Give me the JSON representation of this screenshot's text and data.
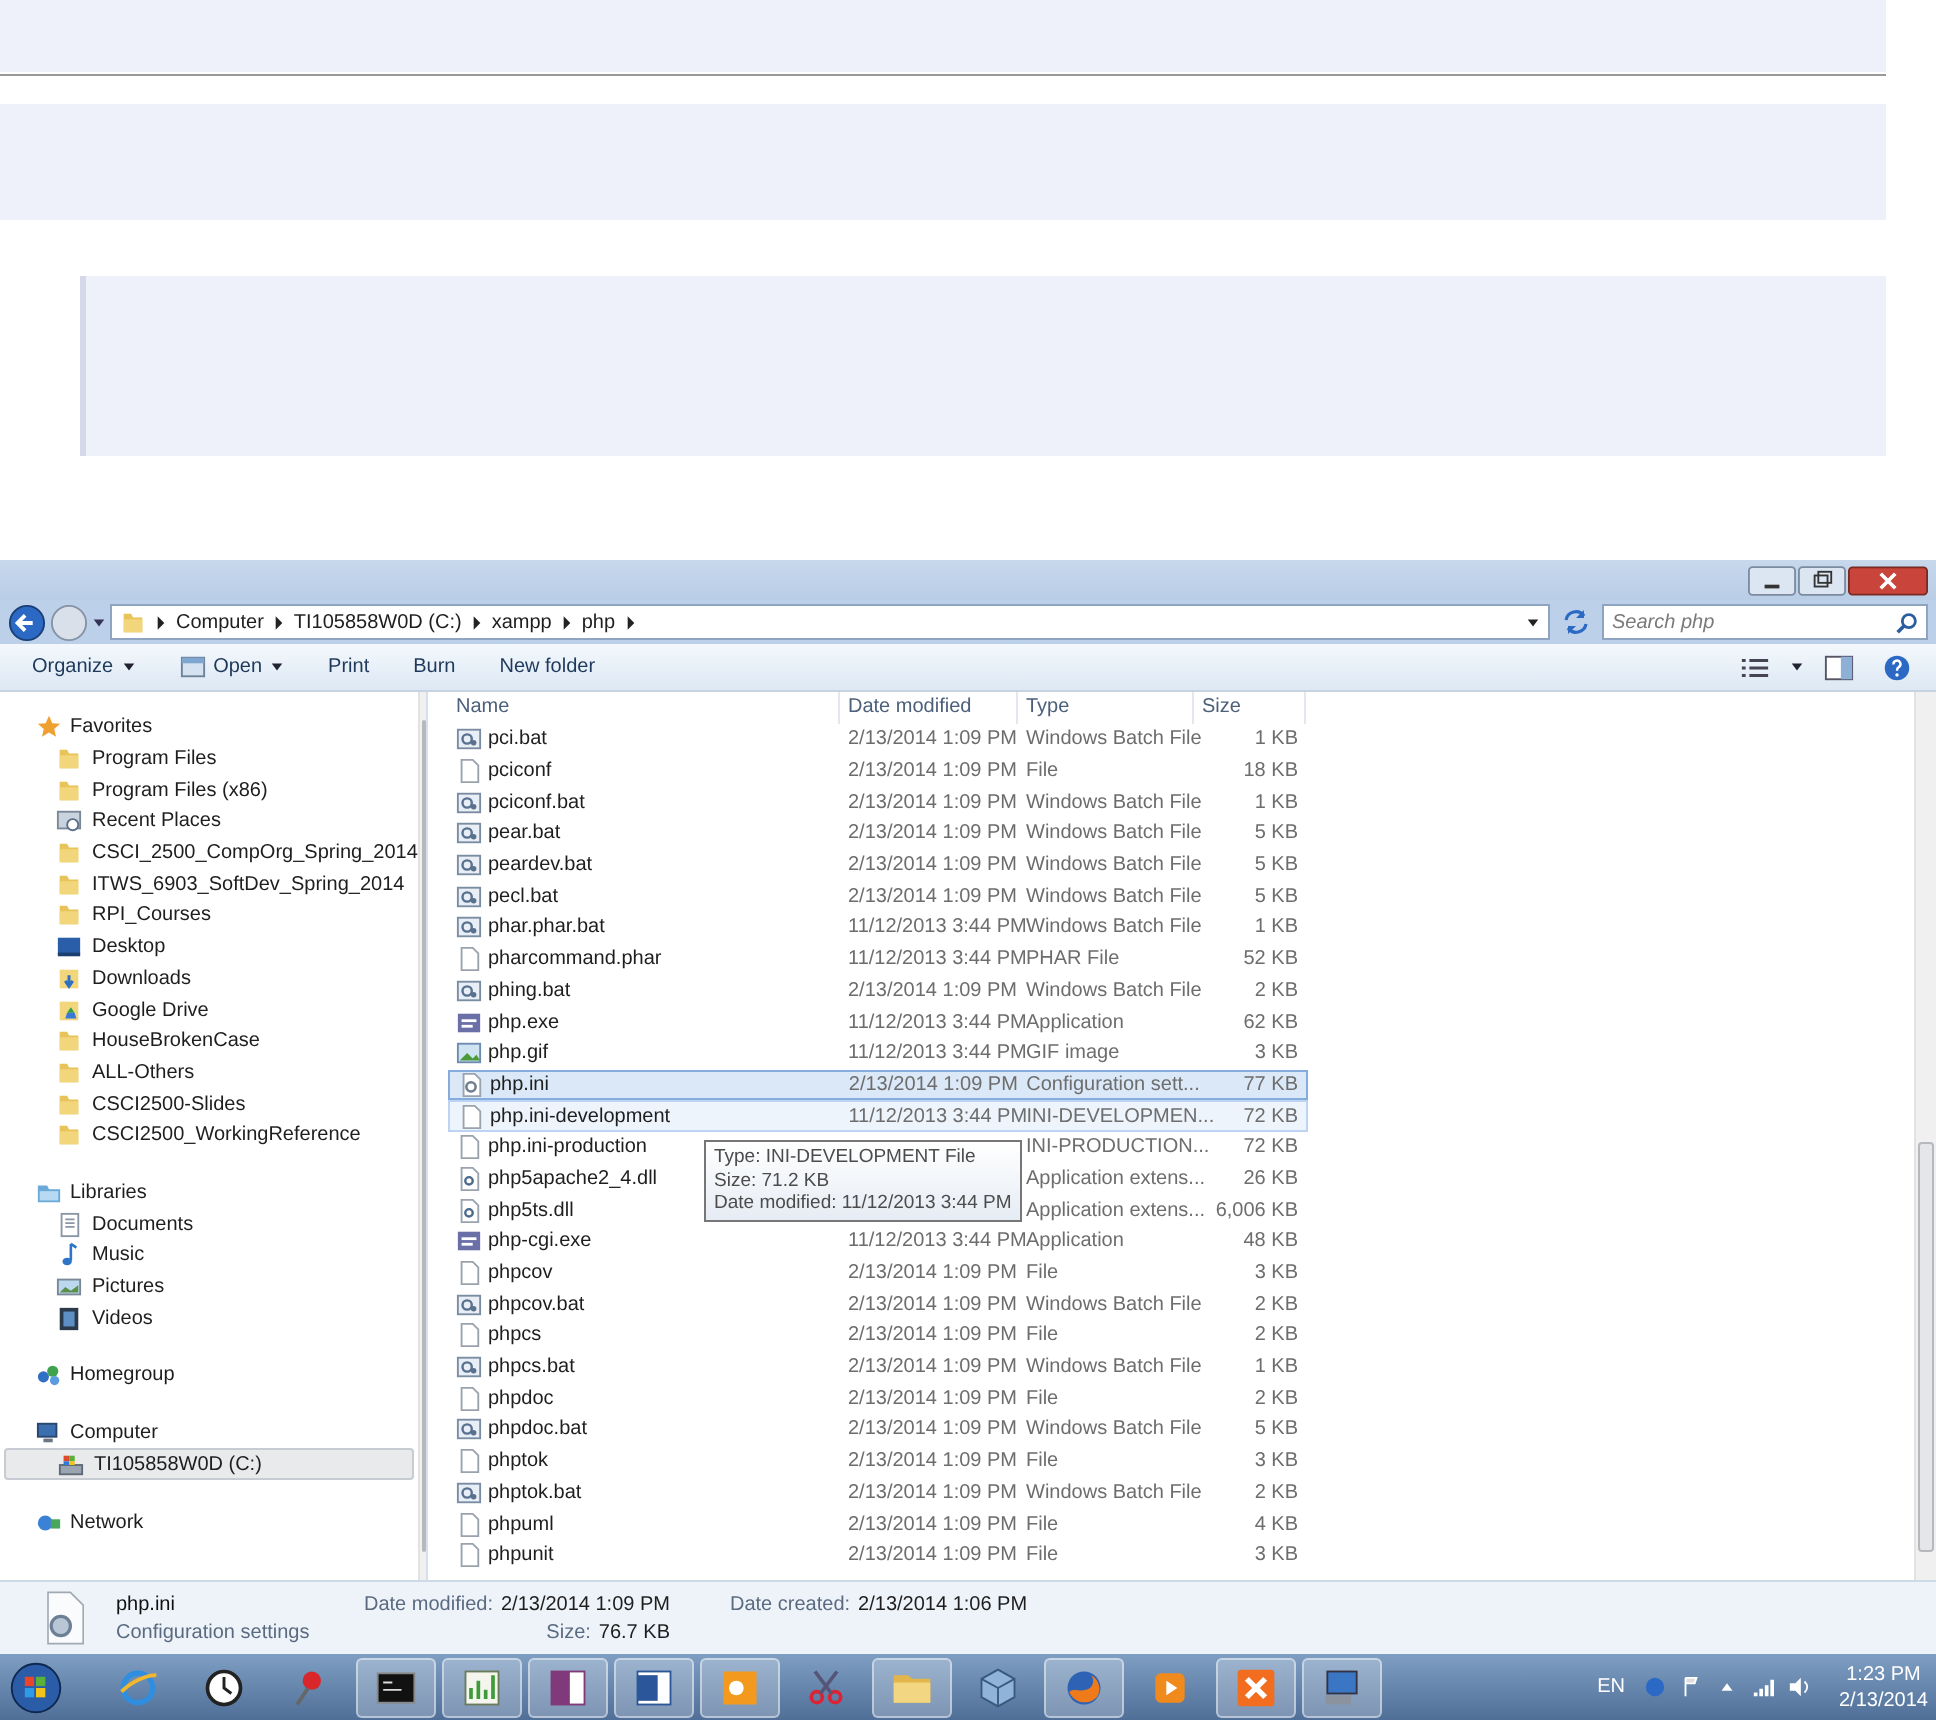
{
  "address": {
    "crumbs": [
      "Computer",
      "TI105858W0D (C:)",
      "xampp",
      "php"
    ],
    "search_placeholder": "Search php"
  },
  "toolbar": [
    {
      "label": "Organize",
      "menu": true,
      "icon": false
    },
    {
      "label": "Open",
      "menu": true,
      "icon": true
    },
    {
      "label": "Print",
      "menu": false,
      "icon": false
    },
    {
      "label": "Burn",
      "menu": false,
      "icon": false
    },
    {
      "label": "New folder",
      "menu": false,
      "icon": false
    }
  ],
  "sidebar": {
    "sections": [
      {
        "label": "Favorites",
        "kind": "star",
        "children": [
          {
            "label": "Program Files",
            "kind": "folder",
            "selected": false
          },
          {
            "label": "Program Files (x86)",
            "kind": "folder",
            "selected": false
          },
          {
            "label": "Recent Places",
            "kind": "recent",
            "selected": false
          },
          {
            "label": "CSCI_2500_CompOrg_Spring_2014",
            "kind": "folder",
            "selected": false
          },
          {
            "label": "ITWS_6903_SoftDev_Spring_2014",
            "kind": "folder",
            "selected": false
          },
          {
            "label": "RPI_Courses",
            "kind": "folder",
            "selected": false
          },
          {
            "label": "Desktop",
            "kind": "desktop",
            "selected": false
          },
          {
            "label": "Downloads",
            "kind": "downloads",
            "selected": false
          },
          {
            "label": "Google Drive",
            "kind": "drive-folder",
            "selected": false
          },
          {
            "label": "HouseBrokenCase",
            "kind": "folder",
            "selected": false
          },
          {
            "label": "ALL-Others",
            "kind": "folder",
            "selected": false
          },
          {
            "label": "CSCI2500-Slides",
            "kind": "folder",
            "selected": false
          },
          {
            "label": "CSCI2500_WorkingReference",
            "kind": "folder",
            "selected": false
          }
        ]
      },
      {
        "label": "Libraries",
        "kind": "library",
        "children": [
          {
            "label": "Documents",
            "kind": "documents",
            "selected": false
          },
          {
            "label": "Music",
            "kind": "music",
            "selected": false
          },
          {
            "label": "Pictures",
            "kind": "pictures",
            "selected": false
          },
          {
            "label": "Videos",
            "kind": "videos",
            "selected": false
          }
        ]
      },
      {
        "label": "Homegroup",
        "kind": "homegroup"
      },
      {
        "label": "Computer",
        "kind": "computer",
        "children": [
          {
            "label": "TI105858W0D (C:)",
            "kind": "disk",
            "selected": true
          }
        ]
      },
      {
        "label": "Network",
        "kind": "network"
      }
    ]
  },
  "table": {
    "columns": [
      "Name",
      "Date modified",
      "Type",
      "Size"
    ],
    "rows": [
      {
        "name": "pci.bat",
        "date": "2/13/2014 1:09 PM",
        "type": "Windows Batch File",
        "size": "1 KB",
        "kind": "bat",
        "selected": false,
        "hovered": false
      },
      {
        "name": "pciconf",
        "date": "2/13/2014 1:09 PM",
        "type": "File",
        "size": "18 KB",
        "kind": "file",
        "selected": false,
        "hovered": false
      },
      {
        "name": "pciconf.bat",
        "date": "2/13/2014 1:09 PM",
        "type": "Windows Batch File",
        "size": "1 KB",
        "kind": "bat",
        "selected": false,
        "hovered": false
      },
      {
        "name": "pear.bat",
        "date": "2/13/2014 1:09 PM",
        "type": "Windows Batch File",
        "size": "5 KB",
        "kind": "bat",
        "selected": false,
        "hovered": false
      },
      {
        "name": "peardev.bat",
        "date": "2/13/2014 1:09 PM",
        "type": "Windows Batch File",
        "size": "5 KB",
        "kind": "bat",
        "selected": false,
        "hovered": false
      },
      {
        "name": "pecl.bat",
        "date": "2/13/2014 1:09 PM",
        "type": "Windows Batch File",
        "size": "5 KB",
        "kind": "bat",
        "selected": false,
        "hovered": false
      },
      {
        "name": "phar.phar.bat",
        "date": "11/12/2013 3:44 PM",
        "type": "Windows Batch File",
        "size": "1 KB",
        "kind": "bat",
        "selected": false,
        "hovered": false
      },
      {
        "name": "pharcommand.phar",
        "date": "11/12/2013 3:44 PM",
        "type": "PHAR File",
        "size": "52 KB",
        "kind": "file",
        "selected": false,
        "hovered": false
      },
      {
        "name": "phing.bat",
        "date": "2/13/2014 1:09 PM",
        "type": "Windows Batch File",
        "size": "2 KB",
        "kind": "bat",
        "selected": false,
        "hovered": false
      },
      {
        "name": "php.exe",
        "date": "11/12/2013 3:44 PM",
        "type": "Application",
        "size": "62 KB",
        "kind": "exe",
        "selected": false,
        "hovered": false
      },
      {
        "name": "php.gif",
        "date": "11/12/2013 3:44 PM",
        "type": "GIF image",
        "size": "3 KB",
        "kind": "image",
        "selected": false,
        "hovered": false
      },
      {
        "name": "php.ini",
        "date": "2/13/2014 1:09 PM",
        "type": "Configuration sett...",
        "size": "77 KB",
        "kind": "config",
        "selected": true,
        "hovered": false
      },
      {
        "name": "php.ini-development",
        "date": "11/12/2013 3:44 PM",
        "type": "INI-DEVELOPMEN...",
        "size": "72 KB",
        "kind": "file",
        "selected": false,
        "hovered": true
      },
      {
        "name": "php.ini-production",
        "type": "INI-PRODUCTION...",
        "size": "72 KB",
        "kind": "file",
        "selected": false,
        "hovered": false
      },
      {
        "name": "php5apache2_4.dll",
        "type": "Application extens...",
        "size": "26 KB",
        "kind": "dll",
        "selected": false,
        "hovered": false
      },
      {
        "name": "php5ts.dll",
        "type": "Application extens...",
        "size": "6,006 KB",
        "kind": "dll",
        "selected": false,
        "hovered": false
      },
      {
        "name": "php-cgi.exe",
        "date": "11/12/2013 3:44 PM",
        "type": "Application",
        "size": "48 KB",
        "kind": "exe",
        "selected": false,
        "hovered": false
      },
      {
        "name": "phpcov",
        "date": "2/13/2014 1:09 PM",
        "type": "File",
        "size": "3 KB",
        "kind": "file",
        "selected": false,
        "hovered": false
      },
      {
        "name": "phpcov.bat",
        "date": "2/13/2014 1:09 PM",
        "type": "Windows Batch File",
        "size": "2 KB",
        "kind": "bat",
        "selected": false,
        "hovered": false
      },
      {
        "name": "phpcs",
        "date": "2/13/2014 1:09 PM",
        "type": "File",
        "size": "2 KB",
        "kind": "file",
        "selected": false,
        "hovered": false
      },
      {
        "name": "phpcs.bat",
        "date": "2/13/2014 1:09 PM",
        "type": "Windows Batch File",
        "size": "1 KB",
        "kind": "bat",
        "selected": false,
        "hovered": false
      },
      {
        "name": "phpdoc",
        "date": "2/13/2014 1:09 PM",
        "type": "File",
        "size": "2 KB",
        "kind": "file",
        "selected": false,
        "hovered": false
      },
      {
        "name": "phpdoc.bat",
        "date": "2/13/2014 1:09 PM",
        "type": "Windows Batch File",
        "size": "5 KB",
        "kind": "bat",
        "selected": false,
        "hovered": false
      },
      {
        "name": "phptok",
        "date": "2/13/2014 1:09 PM",
        "type": "File",
        "size": "3 KB",
        "kind": "file",
        "selected": false,
        "hovered": false
      },
      {
        "name": "phptok.bat",
        "date": "2/13/2014 1:09 PM",
        "type": "Windows Batch File",
        "size": "2 KB",
        "kind": "bat",
        "selected": false,
        "hovered": false
      },
      {
        "name": "phpuml",
        "date": "2/13/2014 1:09 PM",
        "type": "File",
        "size": "4 KB",
        "kind": "file",
        "selected": false,
        "hovered": false
      },
      {
        "name": "phpunit",
        "date": "2/13/2014 1:09 PM",
        "type": "File",
        "size": "3 KB",
        "kind": "file",
        "selected": false,
        "hovered": false
      }
    ]
  },
  "tooltip": {
    "lines": [
      "Type: INI-DEVELOPMENT File",
      "Size: 71.2 KB",
      "Date modified: 11/12/2013 3:44 PM"
    ]
  },
  "details": {
    "name": "php.ini",
    "type": "Configuration settings",
    "fields": [
      {
        "label": "Date modified:",
        "value": "2/13/2014 1:09 PM"
      },
      {
        "label": "Size:",
        "value": "76.7 KB"
      },
      {
        "label": "Date created:",
        "value": "2/13/2014 1:06 PM"
      }
    ]
  },
  "taskbar": {
    "apps": [
      {
        "kind": "browser",
        "running": false
      },
      {
        "kind": "clock",
        "running": false
      },
      {
        "kind": "pin",
        "running": false
      },
      {
        "kind": "terminal",
        "running": true
      },
      {
        "kind": "chart",
        "running": true
      },
      {
        "kind": "notebook",
        "running": true
      },
      {
        "kind": "document",
        "running": true
      },
      {
        "kind": "mail",
        "running": true
      },
      {
        "kind": "scissors",
        "running": false
      },
      {
        "kind": "folder",
        "running": true
      },
      {
        "kind": "cube",
        "running": false
      },
      {
        "kind": "fox",
        "running": true
      },
      {
        "kind": "play",
        "running": false
      },
      {
        "kind": "cross",
        "running": true
      },
      {
        "kind": "monitor",
        "running": true
      }
    ],
    "language": "EN",
    "time": "1:23 PM",
    "date": "2/13/2014"
  }
}
